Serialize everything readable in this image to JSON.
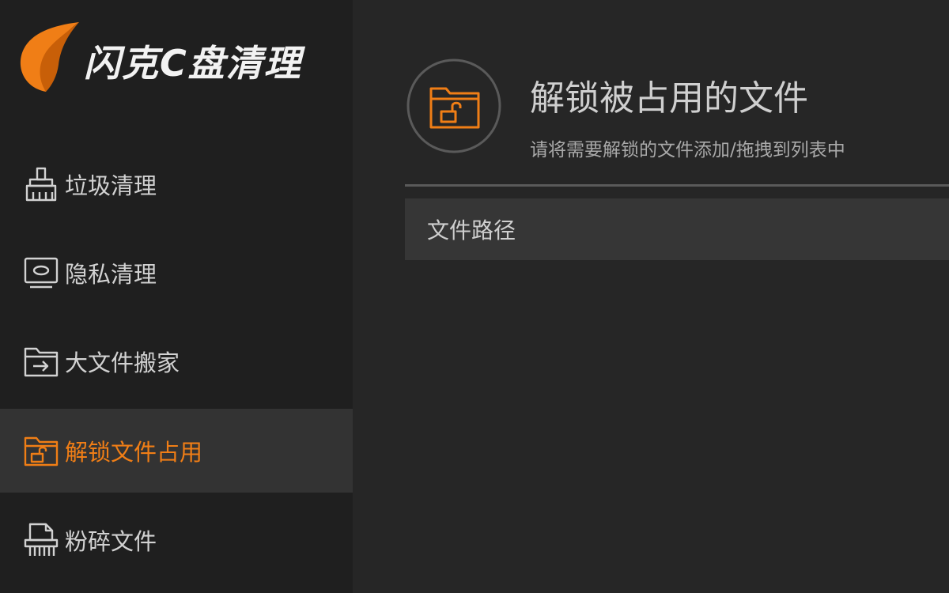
{
  "app": {
    "logo_text": "闪克C盘清理",
    "colors": {
      "accent": "#f07e16",
      "sidebar_bg": "#1f1f1f",
      "main_bg": "#262626",
      "active_item_bg": "#333333",
      "table_header_bg": "#363636"
    }
  },
  "sidebar": {
    "items": [
      {
        "label": "垃圾清理",
        "icon": "broom-icon",
        "active": false
      },
      {
        "label": "隐私清理",
        "icon": "monitor-privacy-icon",
        "active": false
      },
      {
        "label": "大文件搬家",
        "icon": "folder-move-icon",
        "active": false
      },
      {
        "label": "解锁文件占用",
        "icon": "folder-unlock-icon",
        "active": true
      },
      {
        "label": "粉碎文件",
        "icon": "shredder-icon",
        "active": false
      }
    ]
  },
  "main": {
    "header_icon": "folder-unlock-icon",
    "title": "解锁被占用的文件",
    "subtitle": "请将需要解锁的文件添加/拖拽到列表中",
    "table": {
      "columns": [
        "文件路径"
      ],
      "rows": []
    }
  }
}
